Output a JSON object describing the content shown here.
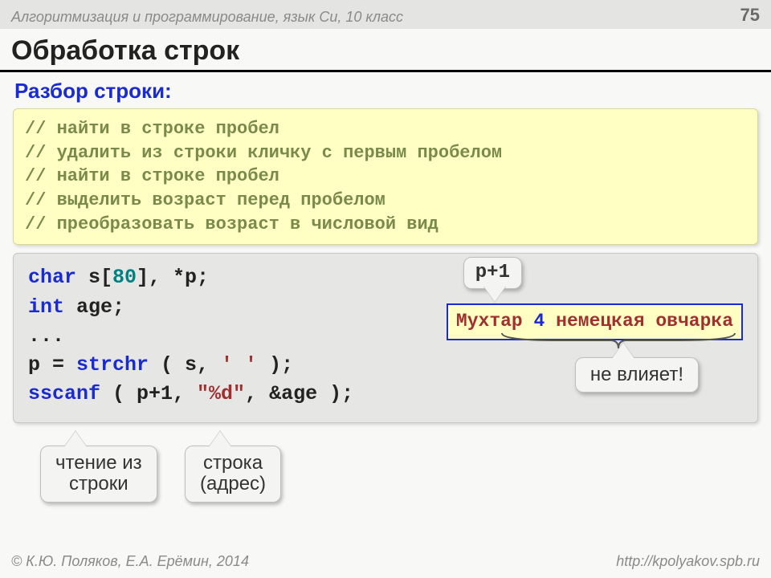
{
  "header": {
    "course": "Алгоритмизация и программирование, язык Си, 10 класс",
    "page": "75"
  },
  "title": "Обработка строк",
  "subtitle": "Разбор строки:",
  "comments": [
    "// найти в строке пробел",
    "// удалить из строки кличку с первым пробелом",
    "// найти в строке пробел",
    "// выделить возраст перед пробелом",
    "// преобразовать возраст в числовой вид"
  ],
  "code": {
    "l1_kw": "char",
    "l1_rest": " s[",
    "l1_num": "80",
    "l1_tail": "], *p;",
    "l2_kw": "int",
    "l2_rest": " age;",
    "l3": "...",
    "l4_a": "p = ",
    "l4_fn": "strchr",
    "l4_b": " ( s, ",
    "l4_lit": "' '",
    "l4_c": " );",
    "l5_fn": "sscanf",
    "l5_a": " ( p+1, ",
    "l5_lit": "\"%d\"",
    "l5_b": ", &age );"
  },
  "sample": {
    "a": "Мухтар ",
    "n": "4",
    "b": " немецкая овчарка"
  },
  "callouts": {
    "p1": "p+1",
    "novliyaet": "не влияет!",
    "read": "чтение из\nстроки",
    "addr": "строка\n(адрес)"
  },
  "footer": {
    "left": "© К.Ю. Поляков, Е.А. Ерёмин, 2014",
    "right": "http://kpolyakov.spb.ru"
  }
}
